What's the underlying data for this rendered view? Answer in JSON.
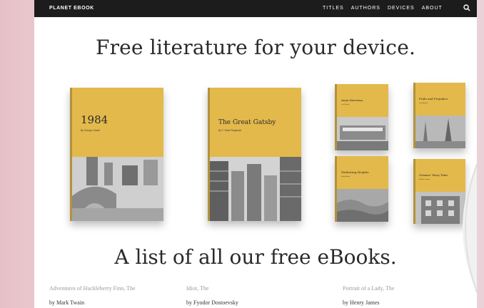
{
  "topbar": {
    "brand": "PLANET EBOOK",
    "nav": [
      "TITLES",
      "AUTHORS",
      "DEVICES",
      "ABOUT"
    ],
    "search_icon": "magnifier"
  },
  "hero": {
    "headline": "Free literature for your device."
  },
  "books": [
    {
      "title": "1984",
      "author": "By George Orwell"
    },
    {
      "title": "The Great Gatsby",
      "author": "By F. Scott Fitzgerald"
    },
    {
      "title": "Anna Karenina",
      "author": "Leo Tolstoy"
    },
    {
      "title": "Pride and Prejudice",
      "author": "Jane Austen"
    },
    {
      "title": "Wuthering Heights",
      "author": "Emily Brontë"
    },
    {
      "title": "Grimms' Fairy Tales",
      "author": "Brothers Grimm"
    }
  ],
  "list": {
    "heading": "A list of all our free eBooks.",
    "items": [
      {
        "title": "Adventures of Huckleberry Finn, The",
        "author": "by Mark Twain"
      },
      {
        "title": "Idiot, The",
        "author": "by Fyodor Dostoevsky"
      },
      {
        "title": "Portrait of a Lady, The",
        "author": "by Henry James"
      }
    ]
  },
  "colors": {
    "topbar": "#1c1c1c",
    "book_cover": "#e3b94b",
    "background_pink": "#e9d3d8"
  }
}
